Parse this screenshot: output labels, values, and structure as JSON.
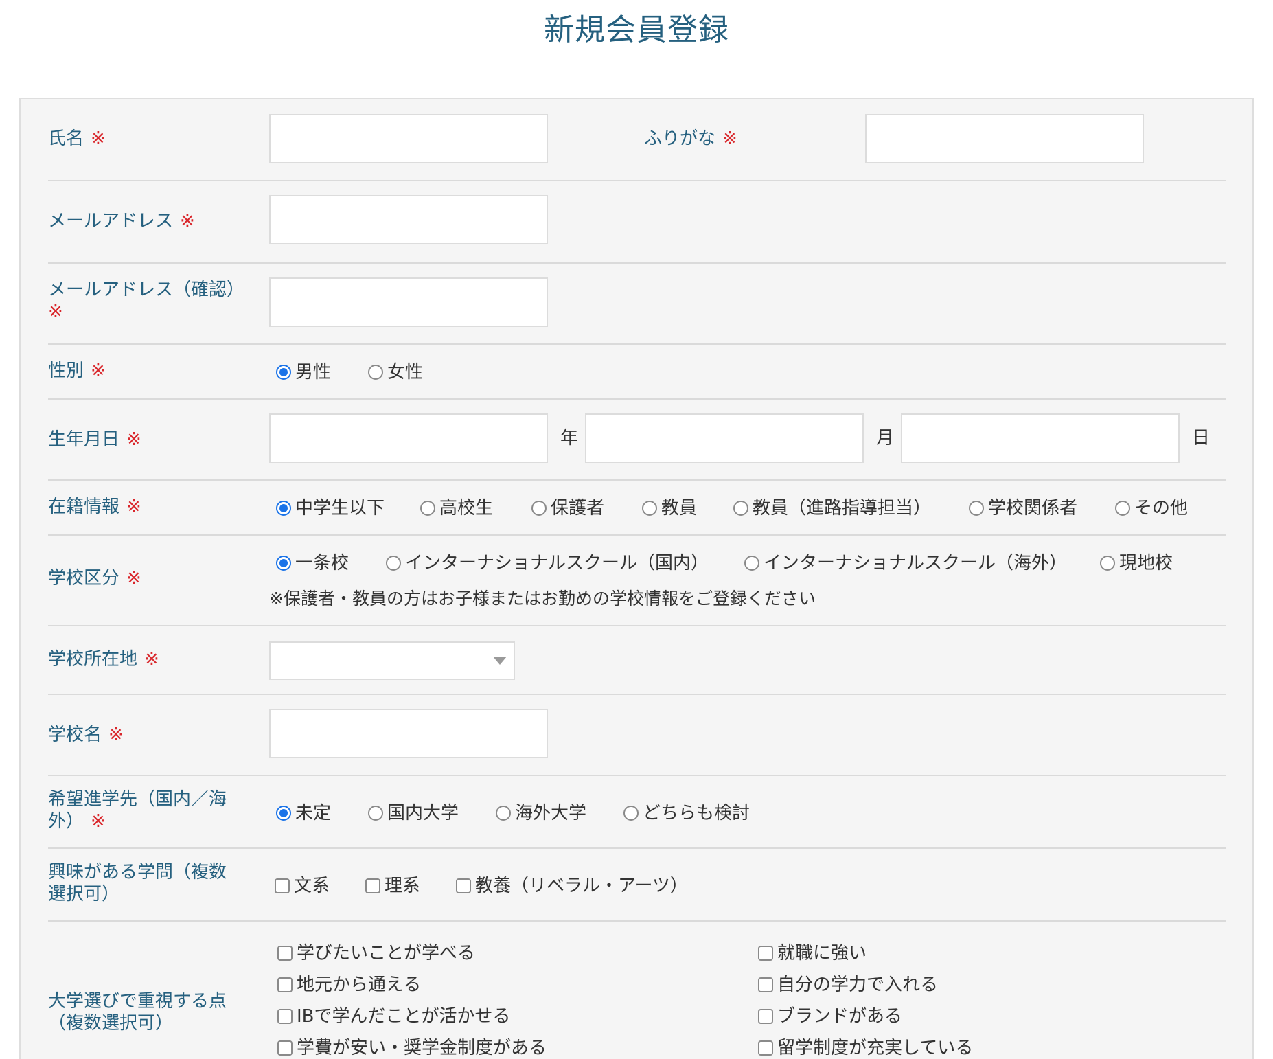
{
  "title": "新規会員登録",
  "required_mark": "※",
  "fields": {
    "name": {
      "label": "氏名"
    },
    "furigana": {
      "label": "ふりがな"
    },
    "email": {
      "label": "メールアドレス"
    },
    "email_confirm": {
      "label": "メールアドレス（確認）"
    },
    "gender": {
      "label": "性別",
      "options": [
        "男性",
        "女性"
      ],
      "selected": "男性"
    },
    "birthday": {
      "label": "生年月日",
      "year_unit": "年",
      "month_unit": "月",
      "day_unit": "日"
    },
    "enrollment": {
      "label": "在籍情報",
      "options": [
        "中学生以下",
        "高校生",
        "保護者",
        "教員",
        "教員（進路指導担当）",
        "学校関係者",
        "その他"
      ],
      "selected": "中学生以下"
    },
    "school_type": {
      "label": "学校区分",
      "options": [
        "一条校",
        "インターナショナルスクール（国内）",
        "インターナショナルスクール（海外）",
        "現地校"
      ],
      "selected": "一条校",
      "note": "※保護者・教員の方はお子様またはお勤めの学校情報をご登録ください"
    },
    "school_location": {
      "label": "学校所在地",
      "value": ""
    },
    "school_name": {
      "label": "学校名"
    },
    "destination": {
      "label_line1": "希望進学先（国内／海",
      "label_line2": "外）",
      "options": [
        "未定",
        "国内大学",
        "海外大学",
        "どちらも検討"
      ],
      "selected": "未定"
    },
    "interests": {
      "label_line1": "興味がある学問（複数",
      "label_line2": "選択可）",
      "options": [
        "文系",
        "理系",
        "教養（リベラル・アーツ）"
      ]
    },
    "priorities": {
      "label_line1": "大学選びで重視する点",
      "label_line2": "（複数選択可）",
      "options_left": [
        "学びたいことが学べる",
        "地元から通える",
        "IBで学んだことが活かせる",
        "学費が安い・奨学金制度がある"
      ],
      "options_right": [
        "就職に強い",
        "自分の学力で入れる",
        "ブランドがある",
        "留学制度が充実している"
      ]
    }
  }
}
